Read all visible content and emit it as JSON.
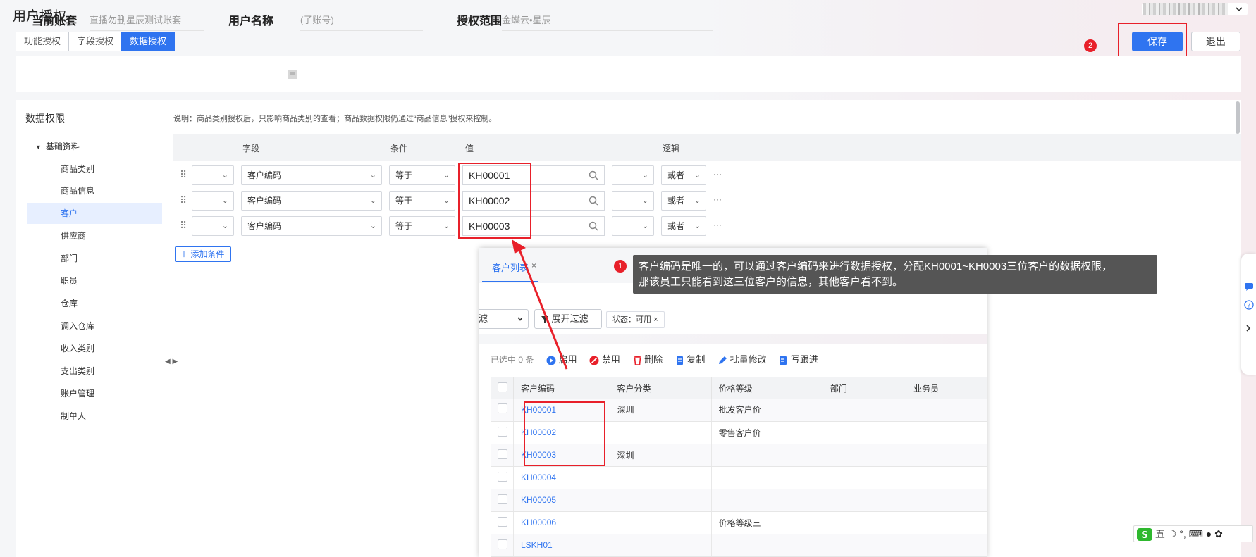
{
  "page_title": "用户授权",
  "tabs": [
    {
      "label": "功能授权",
      "active": false
    },
    {
      "label": "字段授权",
      "active": false
    },
    {
      "label": "数据授权",
      "active": true
    }
  ],
  "actions": {
    "save": "保存",
    "exit": "退出",
    "save_badge": "2"
  },
  "info": {
    "account_label": "当前账套",
    "account_value": "直播勿删星辰测试账套",
    "username_label": "用户名称",
    "username_value": "(子账号)",
    "scope_label": "授权范围",
    "scope_value": "金蝶云•星辰"
  },
  "tree": {
    "title": "数据权限",
    "root": "基础资料",
    "items": [
      "商品类别",
      "商品信息",
      "客户",
      "供应商",
      "部门",
      "职员",
      "仓库",
      "调入仓库",
      "收入类别",
      "支出类别",
      "账户管理",
      "制单人"
    ],
    "active_index": 2
  },
  "note": "说明：商品类别授权后，只影响商品类别的查看；商品数据权限仍通过“商品信息”授权来控制。",
  "condition_columns": {
    "field": "字段",
    "condition": "条件",
    "value": "值",
    "logic": "逻辑"
  },
  "conditions": [
    {
      "field": "客户编码",
      "op": "等于",
      "value": "KH00001",
      "logic": "或者"
    },
    {
      "field": "客户编码",
      "op": "等于",
      "value": "KH00002",
      "logic": "或者"
    },
    {
      "field": "客户编码",
      "op": "等于",
      "value": "KH00003",
      "logic": "或者"
    }
  ],
  "add_condition": "添加条件",
  "popup": {
    "tab_label": "客户列表",
    "filter_select": "滤",
    "filter_button": "展开过滤",
    "status_tag": "状态：可用",
    "selected_count": "已选中 0 条",
    "toolbar": [
      "启用",
      "禁用",
      "删除",
      "复制",
      "批量修改",
      "写跟进"
    ],
    "columns": [
      "客户编码",
      "客户分类",
      "价格等级",
      "部门",
      "业务员"
    ],
    "rows": [
      {
        "code": "KH00001",
        "category": "深圳",
        "price": "批发客户价"
      },
      {
        "code": "KH00002",
        "category": "",
        "price": "零售客户价"
      },
      {
        "code": "KH00003",
        "category": "深圳",
        "price": ""
      },
      {
        "code": "KH00004",
        "category": "",
        "price": ""
      },
      {
        "code": "KH00005",
        "category": "",
        "price": ""
      },
      {
        "code": "KH00006",
        "category": "",
        "price": "价格等级三"
      },
      {
        "code": "LSKH01",
        "category": "",
        "price": ""
      }
    ]
  },
  "callout": {
    "badge": "1",
    "line1": "客户编码是唯一的，可以通过客户编码来进行数据授权，分配KH0001~KH0003三位客户的数据权限，",
    "line2": "那该员工只能看到这三位客户的信息，其他客户看不到。"
  },
  "ime": {
    "label": "五"
  },
  "colors": {
    "primary": "#2f74f0",
    "annotation_red": "#e8202a",
    "callout_bg": "#555555"
  }
}
